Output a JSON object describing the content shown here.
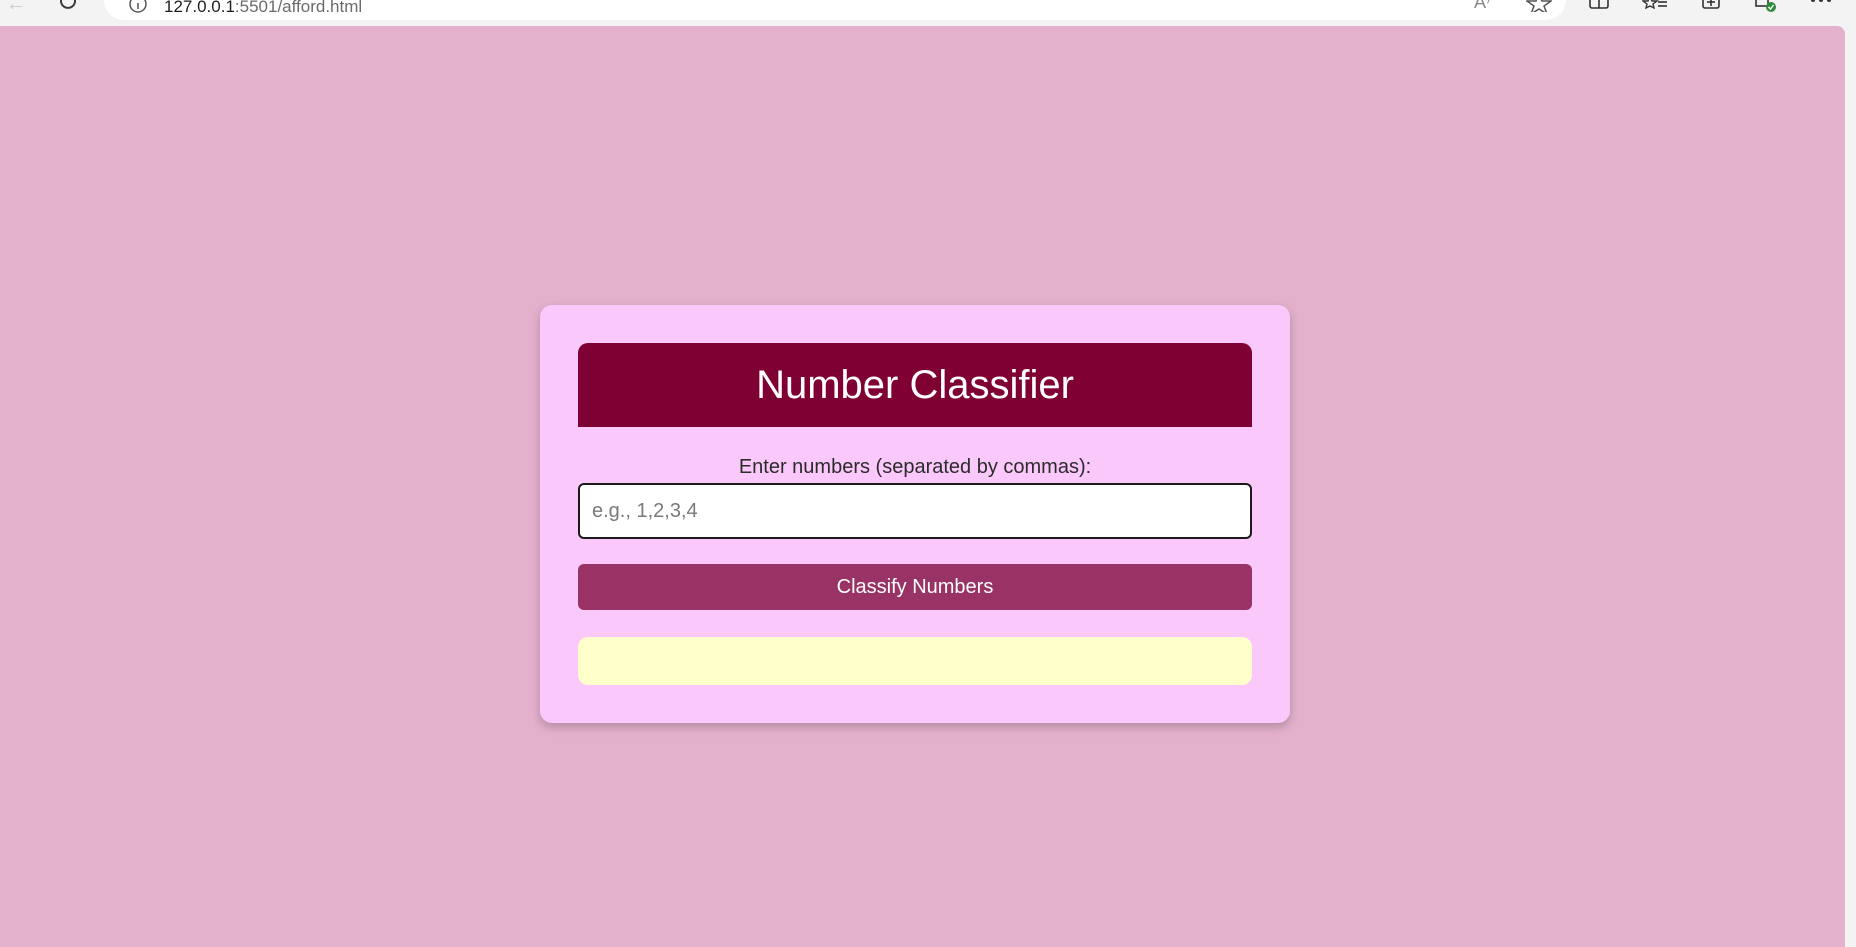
{
  "browser": {
    "url_host": "127.0.0.1",
    "url_rest": ":5501/afford.html",
    "read_aloud_label": "A⁾",
    "icons": [
      "back-icon",
      "refresh-icon",
      "info-icon",
      "read-aloud-icon",
      "favorite-star-icon",
      "split-screen-icon",
      "favorites-list-icon",
      "collections-icon",
      "extension-icon",
      "more-menu-icon"
    ]
  },
  "card": {
    "title": "Number Classifier",
    "input_label": "Enter numbers (separated by commas):",
    "input_value": "",
    "input_placeholder": "e.g., 1,2,3,4",
    "button_label": "Classify Numbers",
    "result_text": ""
  },
  "colors": {
    "page_background": "#e4b1cd",
    "card_background": "#fbc8fb",
    "header_background": "#7f0033",
    "button_background": "#993366",
    "result_background": "#ffffcc"
  }
}
